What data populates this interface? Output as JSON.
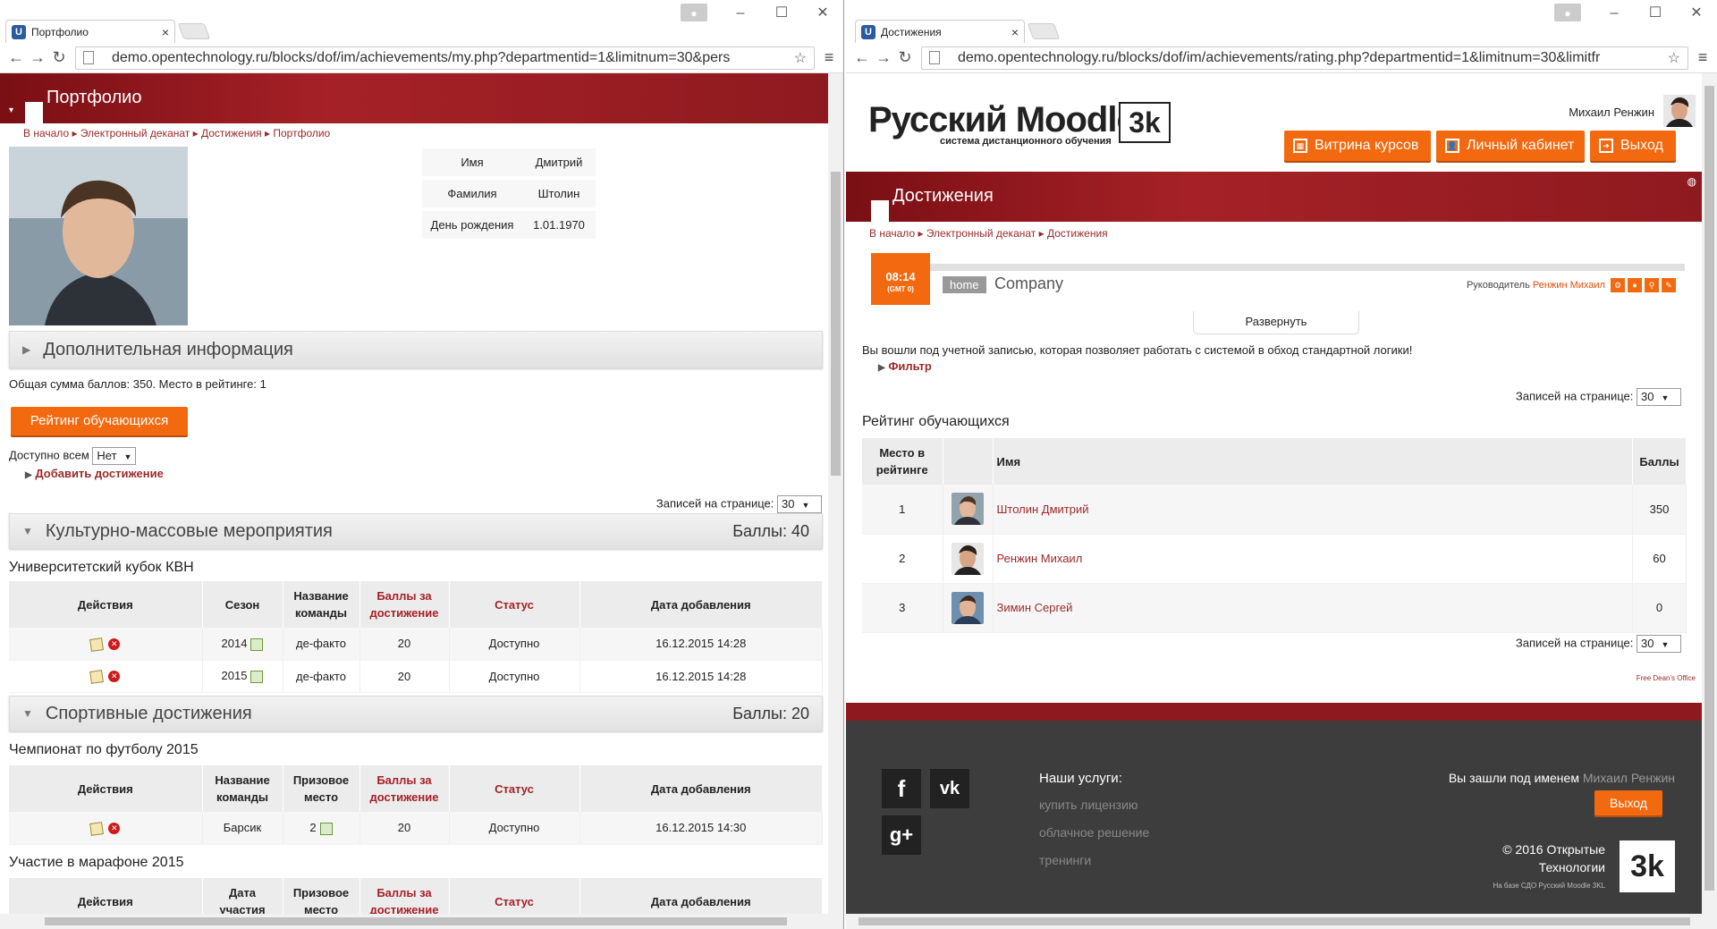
{
  "left": {
    "tab_title": "Портфолио",
    "url": "demo.opentechnology.ru/blocks/dof/im/achievements/my.php?departmentid=1&limitnum=30&pers",
    "page_title": "Портфолио",
    "breadcrumb": [
      "В начало",
      "Электронный деканат",
      "Достижения",
      "Портфолио"
    ],
    "profile": {
      "rows": [
        {
          "label": "Имя",
          "value": "Дмитрий"
        },
        {
          "label": "Фамилия",
          "value": "Штолин"
        },
        {
          "label": "День рождения",
          "value": "1.01.1970"
        }
      ]
    },
    "additional_info": "Дополнительная информация",
    "total_text": "Общая сумма баллов: 350. Место в рейтинге: 1",
    "rating_button": "Рейтинг обучающихся",
    "available_label": "Доступно всем",
    "available_value": "Нет",
    "add_achievement": "Добавить достижение",
    "per_page_label": "Записей на странице:",
    "per_page_value": "30",
    "sections": [
      {
        "title": "Культурно-массовые мероприятия",
        "score": "Баллы: 40",
        "subtitle": "Университетский кубок КВН",
        "headers": [
          "Действия",
          "Сезон",
          "Название команды",
          "Баллы за достижение",
          "Статус",
          "Дата добавления"
        ],
        "rows": [
          [
            "",
            "2014",
            "де-факто",
            "20",
            "Доступно",
            "16.12.2015 14:28"
          ],
          [
            "",
            "2015",
            "де-факто",
            "20",
            "Доступно",
            "16.12.2015 14:28"
          ]
        ]
      },
      {
        "title": "Спортивные достижения",
        "score": "Баллы: 20",
        "subtitle": "Чемпионат по футболу 2015",
        "headers": [
          "Действия",
          "Название команды",
          "Призовое место",
          "Баллы за достижение",
          "Статус",
          "Дата добавления"
        ],
        "rows": [
          [
            "",
            "Барсик",
            "2",
            "20",
            "Доступно",
            "16.12.2015 14:30"
          ]
        ]
      }
    ],
    "marathon": {
      "subtitle": "Участие в марафоне 2015",
      "headers": [
        "Действия",
        "Дата участия",
        "Призовое место",
        "Баллы за достижение",
        "Статус",
        "Дата добавления"
      ]
    }
  },
  "right": {
    "tab_title": "Достижения",
    "url": "demo.opentechnology.ru/blocks/dof/im/achievements/rating.php?departmentid=1&limitnum=30&limitfr",
    "logo_text": "Русский Moodle",
    "logo_sub": "система дистанционного обучения",
    "logo_mark": "3k",
    "user_name": "Михаил Ренжин",
    "nav_buttons": [
      "Витрина курсов",
      "Личный кабинет",
      "Выход"
    ],
    "page_title": "Достижения",
    "breadcrumb": [
      "В начало",
      "Электронный деканат",
      "Достижения"
    ],
    "clock": "08:14",
    "clock_tz": "(GMT 0)",
    "home_label": "home",
    "company": "Company",
    "manager_label": "Руководитель",
    "manager_name": "Ренжин Михаил",
    "expand": "Развернуть",
    "notice": "Вы вошли под учетной записью, которая позволяет работать с системой в обход стандартной логики!",
    "filter": "Фильтр",
    "per_page_label": "Записей на странице:",
    "per_page_value": "30",
    "rating_title": "Рейтинг обучающихся",
    "rating_headers": [
      "Место в рейтинге",
      "",
      "Имя",
      "Баллы"
    ],
    "rating_rows": [
      {
        "place": "1",
        "name": "Штолин Дмитрий",
        "score": "350"
      },
      {
        "place": "2",
        "name": "Ренжин Михаил",
        "score": "60"
      },
      {
        "place": "3",
        "name": "Зимин Сергей",
        "score": "0"
      }
    ],
    "free_dean": "Free Dean's Office",
    "footer": {
      "services_title": "Наши услуги:",
      "services": [
        "купить лицензию",
        "облачное решение",
        "тренинги"
      ],
      "logged_as": "Вы зашли под именем",
      "logged_name": "Михаил Ренжин",
      "logout": "Выход",
      "copyright": "© 2016 Открытые Технологии",
      "based_on": "На базе СДО Русский Moodle 3KL",
      "social": [
        "f",
        "vk",
        "g+"
      ]
    }
  }
}
